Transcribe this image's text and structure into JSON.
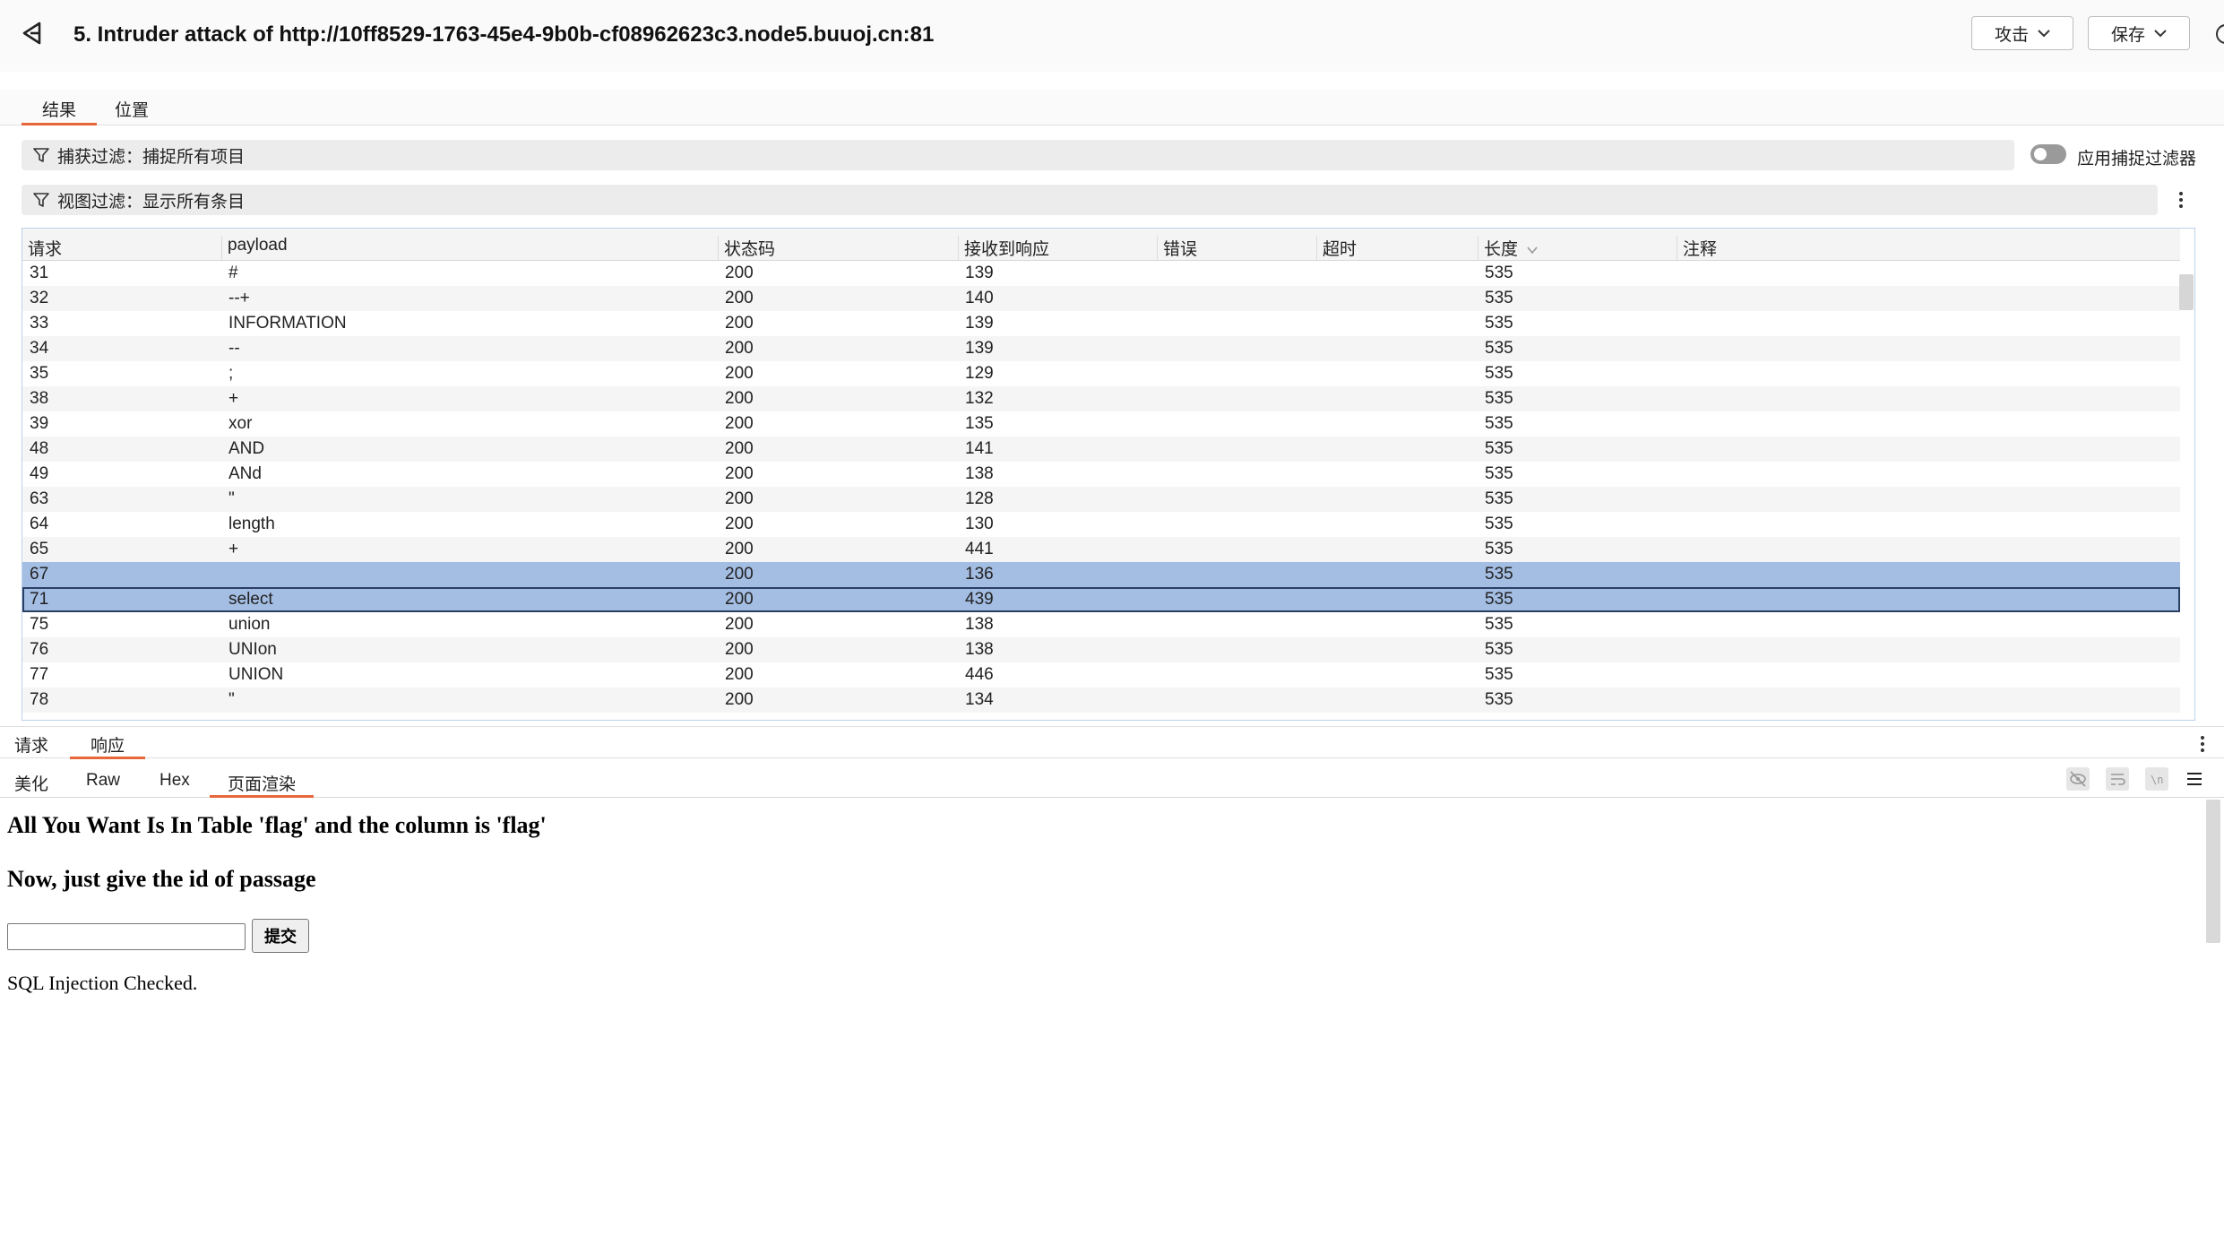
{
  "header": {
    "title": "5. Intruder attack of http://10ff8529-1763-45e4-9b0b-cf08962623c3.node5.buuoj.cn:81",
    "attack_label": "攻击",
    "save_label": "保存"
  },
  "main_tabs": {
    "results": "结果",
    "positions": "位置"
  },
  "filters": {
    "capture": "捕获过滤：捕捉所有项目",
    "view": "视图过滤：显示所有条目",
    "apply_capture_label": "应用捕捉过滤器"
  },
  "table": {
    "columns": [
      "请求",
      "payload",
      "状态码",
      "接收到响应",
      "错误",
      "超时",
      "长度",
      "注释"
    ],
    "rows": [
      {
        "req": "31",
        "payload": "#",
        "status": "200",
        "received": "139",
        "error": "",
        "timeout": "",
        "length": "535",
        "comment": ""
      },
      {
        "req": "32",
        "payload": "--+",
        "status": "200",
        "received": "140",
        "error": "",
        "timeout": "",
        "length": "535",
        "comment": ""
      },
      {
        "req": "33",
        "payload": "INFORMATION",
        "status": "200",
        "received": "139",
        "error": "",
        "timeout": "",
        "length": "535",
        "comment": ""
      },
      {
        "req": "34",
        "payload": "--",
        "status": "200",
        "received": "139",
        "error": "",
        "timeout": "",
        "length": "535",
        "comment": ""
      },
      {
        "req": "35",
        "payload": ";",
        "status": "200",
        "received": "129",
        "error": "",
        "timeout": "",
        "length": "535",
        "comment": ""
      },
      {
        "req": "38",
        "payload": "+",
        "status": "200",
        "received": "132",
        "error": "",
        "timeout": "",
        "length": "535",
        "comment": ""
      },
      {
        "req": "39",
        "payload": "xor",
        "status": "200",
        "received": "135",
        "error": "",
        "timeout": "",
        "length": "535",
        "comment": ""
      },
      {
        "req": "48",
        "payload": "AND",
        "status": "200",
        "received": "141",
        "error": "",
        "timeout": "",
        "length": "535",
        "comment": ""
      },
      {
        "req": "49",
        "payload": "ANd",
        "status": "200",
        "received": "138",
        "error": "",
        "timeout": "",
        "length": "535",
        "comment": ""
      },
      {
        "req": "63",
        "payload": "\"",
        "status": "200",
        "received": "128",
        "error": "",
        "timeout": "",
        "length": "535",
        "comment": ""
      },
      {
        "req": "64",
        "payload": "length",
        "status": "200",
        "received": "130",
        "error": "",
        "timeout": "",
        "length": "535",
        "comment": ""
      },
      {
        "req": "65",
        "payload": "+",
        "status": "200",
        "received": "441",
        "error": "",
        "timeout": "",
        "length": "535",
        "comment": ""
      },
      {
        "req": "67",
        "payload": "",
        "status": "200",
        "received": "136",
        "error": "",
        "timeout": "",
        "length": "535",
        "comment": ""
      },
      {
        "req": "71",
        "payload": "select",
        "status": "200",
        "received": "439",
        "error": "",
        "timeout": "",
        "length": "535",
        "comment": ""
      },
      {
        "req": "75",
        "payload": "union",
        "status": "200",
        "received": "138",
        "error": "",
        "timeout": "",
        "length": "535",
        "comment": ""
      },
      {
        "req": "76",
        "payload": "UNIon",
        "status": "200",
        "received": "138",
        "error": "",
        "timeout": "",
        "length": "535",
        "comment": ""
      },
      {
        "req": "77",
        "payload": "UNION",
        "status": "200",
        "received": "446",
        "error": "",
        "timeout": "",
        "length": "535",
        "comment": ""
      },
      {
        "req": "78",
        "payload": "\"",
        "status": "200",
        "received": "134",
        "error": "",
        "timeout": "",
        "length": "535",
        "comment": ""
      }
    ]
  },
  "bottom_tabs": {
    "request": "请求",
    "response": "响应"
  },
  "view_tabs": {
    "pretty": "美化",
    "raw": "Raw",
    "hex": "Hex",
    "render": "页面渲染"
  },
  "render": {
    "heading1": "All You Want Is In Table 'flag' and the column is 'flag'",
    "heading2": "Now, just give the id of passage",
    "submit": "提交",
    "status": "SQL Injection Checked."
  },
  "colors": {
    "accent": "#e8673a",
    "selection": "#a3bde3",
    "selection_border": "#2a3f63"
  }
}
